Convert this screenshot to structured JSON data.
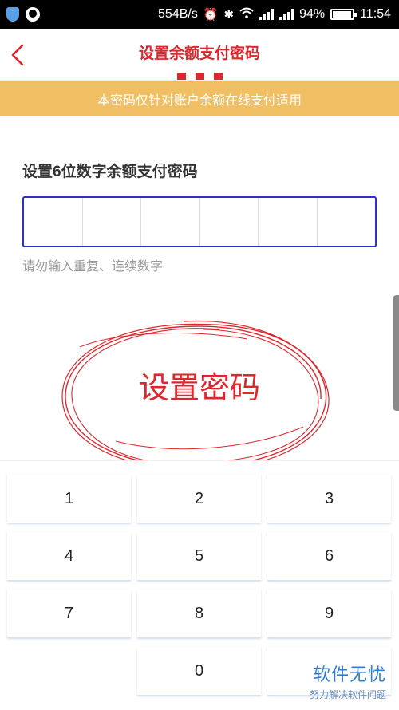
{
  "status_bar": {
    "network_speed": "554B/s",
    "battery_percent": "94%",
    "time": "11:54",
    "icons": [
      "shield-app-icon",
      "qq-app-icon",
      "alarm-icon",
      "bluetooth-icon",
      "wifi-icon",
      "signal-icon",
      "battery-icon"
    ]
  },
  "header": {
    "title": "设置余额支付密码",
    "back_icon": "chevron-left-icon"
  },
  "notice": {
    "text": "本密码仅针对账户余额在线支付适用"
  },
  "form": {
    "label": "设置6位数字余额支付密码",
    "pin_length": 6,
    "hint": "请勿输入重复、连续数字"
  },
  "annotation": {
    "text": "设置密码"
  },
  "keypad": {
    "keys": [
      "1",
      "2",
      "3",
      "4",
      "5",
      "6",
      "7",
      "8",
      "9",
      "0"
    ]
  },
  "watermark": {
    "main": "软件无忧",
    "sub": "努力解决软件问题"
  },
  "colors": {
    "accent": "#e0262d",
    "banner": "#f0bf64",
    "input_border": "#2b2ec9",
    "hint_text": "#9a9a9a"
  }
}
